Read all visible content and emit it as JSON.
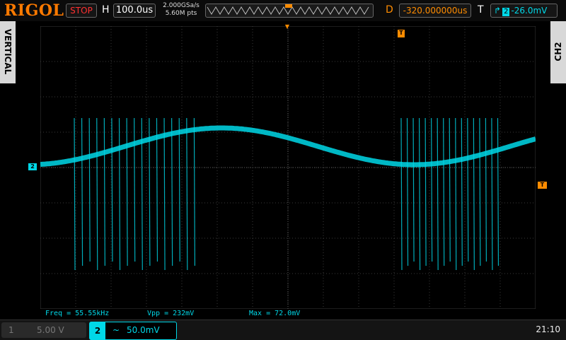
{
  "brand": "RIGOL",
  "run_state": "STOP",
  "horizontal": {
    "label": "H",
    "timebase": "100.0us"
  },
  "acquisition": {
    "rate": "2.000GSa/s",
    "points": "5.60M pts"
  },
  "delay": {
    "label": "D",
    "value": "-320.000000us"
  },
  "trigger": {
    "label": "T",
    "source": "2",
    "level": "-26.0mV",
    "marker_label": "T"
  },
  "side_tabs": {
    "left": "VERTICAL",
    "right": "CH2"
  },
  "channel_marker": "2",
  "measurements": [
    {
      "text": "Freq = 55.55kHz"
    },
    {
      "text": "Vpp = 232mV"
    },
    {
      "text": "Max = 72.0mV"
    }
  ],
  "channels": [
    {
      "number": "1",
      "scale": "5.00 V"
    },
    {
      "number": "2",
      "coupling": "~",
      "scale": "50.0mV"
    }
  ],
  "clock": "21:10",
  "colors": {
    "trace": "#00d8e8",
    "accent": "#ff8c00",
    "stop": "#ff3030"
  }
}
